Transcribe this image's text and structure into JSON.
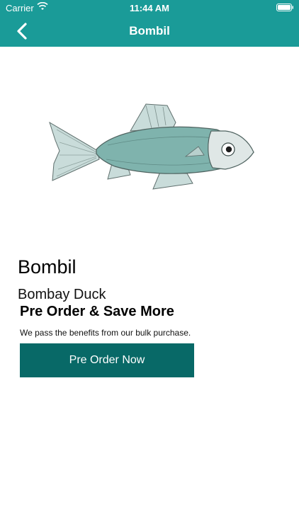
{
  "status_bar": {
    "carrier": "Carrier",
    "time": "11:44 AM",
    "icons": [
      "wifi-icon",
      "battery-icon"
    ]
  },
  "nav": {
    "title": "Bombil",
    "back_icon": "chevron-left-icon"
  },
  "product": {
    "image_icon": "fish-illustration",
    "name": "Bombil",
    "alt_name": "Bombay Duck"
  },
  "promo": {
    "title": "Pre Order & Save More",
    "subtitle": "We pass the benefits from our bulk purchase.",
    "button_label": "Pre Order Now"
  },
  "colors": {
    "navbar": "#1a9b98",
    "button": "#086967",
    "fish_body": "#7fb3ad",
    "fish_fin": "#c9dcda"
  }
}
